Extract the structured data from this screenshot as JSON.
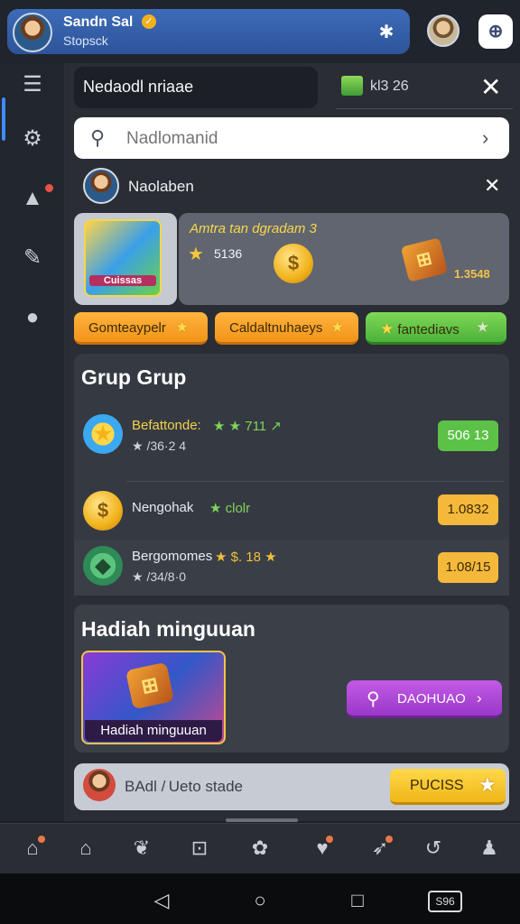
{
  "header": {
    "user_name": "Sandn Sal",
    "user_status": "Stopsck",
    "verified_icon": "check-icon",
    "settings_icon": "gear-icon",
    "corner_icon": "app-icon"
  },
  "sidebar": {
    "items": [
      {
        "icon": "menu-icon"
      },
      {
        "icon": "gear-icon"
      },
      {
        "icon": "alert-icon"
      },
      {
        "icon": "edit-icon"
      },
      {
        "icon": "location-icon"
      }
    ]
  },
  "top_search": {
    "value": "Nedaodl nriaae",
    "kb_label": "kl3 26"
  },
  "search": {
    "placeholder": "Nadlomanid"
  },
  "user_row": {
    "name": "Naolaben"
  },
  "game_card": {
    "thumb_label": "Cuissas"
  },
  "promo": {
    "title": "Amtra tan dgradam 3",
    "value": "5136",
    "value2": "1.3548"
  },
  "pills": [
    {
      "label": "Gomteaypelr",
      "color": "#f29418"
    },
    {
      "label": "Caldaltnuhaeys",
      "color": "#f29418"
    },
    {
      "label": "fantediavs",
      "color": "#4cb23a"
    }
  ],
  "group": {
    "title": "Grup Grup",
    "rows": [
      {
        "line1": "Befattonde:",
        "line1b": "★ ★ 711 ↗",
        "line2": "★ /36·2 4",
        "button": "506 13"
      },
      {
        "line1": "Nengohak",
        "line1b": "★ clolr",
        "line2": "",
        "button": "1.0832"
      },
      {
        "line1": "Bergomomes",
        "line1b": "★ $. 18 ★",
        "line2": "★ /34/8·0",
        "button": "1.08/15"
      }
    ]
  },
  "reward": {
    "title": "Hadiah minguuan",
    "image_caption": "Hadiah minguuan",
    "cta_label": "DAOHUAO"
  },
  "bottom_card": {
    "label": "BAdl / Ueto stade",
    "button": "PUCISS"
  },
  "tabbar": {
    "items": [
      {
        "icon": "bell-badge-icon"
      },
      {
        "icon": "home-icon"
      },
      {
        "icon": "leaf-icon"
      },
      {
        "icon": "chart-icon"
      },
      {
        "icon": "clover-icon"
      },
      {
        "icon": "gift-badge-icon"
      },
      {
        "icon": "tool-badge-icon"
      },
      {
        "icon": "back-icon"
      },
      {
        "icon": "profile-icon"
      }
    ]
  },
  "navbar": {
    "kbd_label": "S96"
  }
}
